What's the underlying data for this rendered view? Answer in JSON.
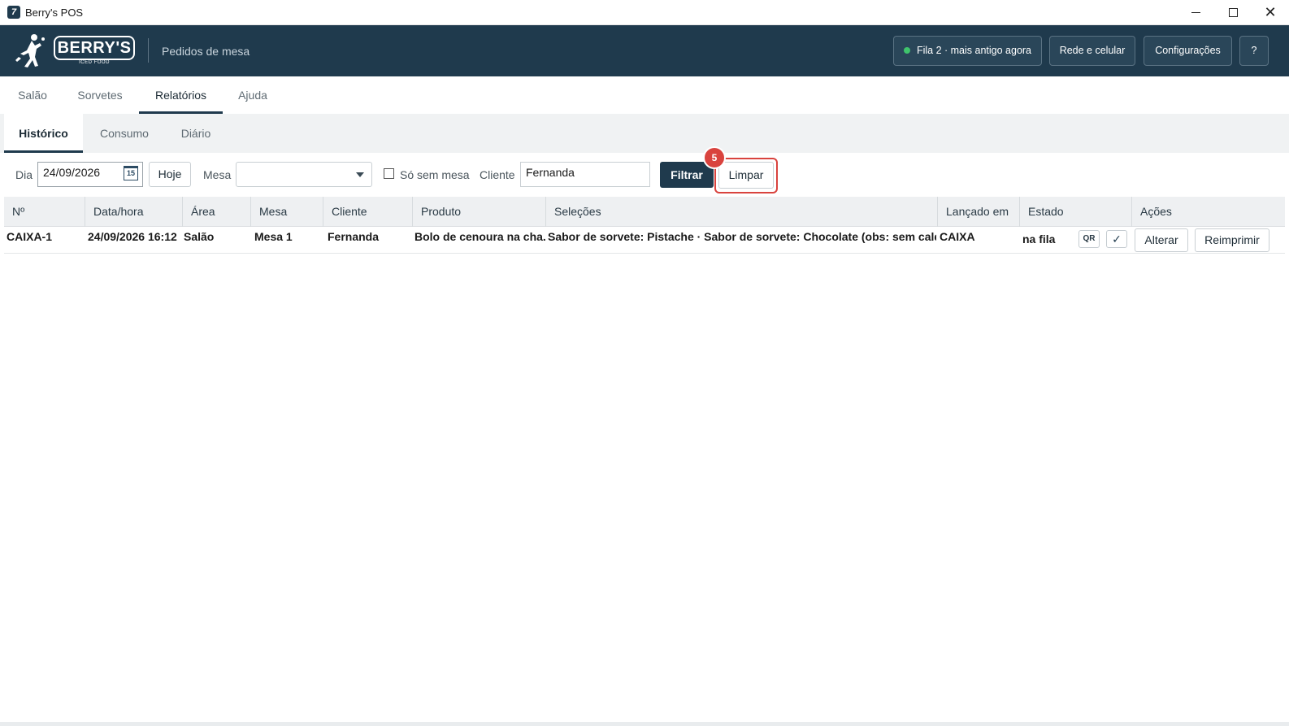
{
  "window": {
    "title": "Berry's POS",
    "app_icon_glyph": "7"
  },
  "header": {
    "logo_text": "BERRY'S",
    "logo_subtext": "ICED FOOD",
    "title": "Pedidos de mesa",
    "queue_status": "Fila 2 · mais antigo agora",
    "queue_dot_color": "#3fc46c",
    "network_button": "Rede e celular",
    "settings_button": "Configurações",
    "help_button": "?"
  },
  "main_tabs": [
    {
      "label": "Salão",
      "active": false
    },
    {
      "label": "Sorvetes",
      "active": false
    },
    {
      "label": "Relatórios",
      "active": true
    },
    {
      "label": "Ajuda",
      "active": false
    }
  ],
  "sub_tabs": [
    {
      "label": "Histórico",
      "active": true
    },
    {
      "label": "Consumo",
      "active": false
    },
    {
      "label": "Diário",
      "active": false
    }
  ],
  "filters": {
    "day_label": "Dia",
    "day_value": "24/09/2026",
    "calendar_glyph": "15",
    "today_button": "Hoje",
    "table_label": "Mesa",
    "table_value": "",
    "no_table_label": "Só sem mesa",
    "no_table_checked": false,
    "client_label": "Cliente",
    "client_value": "Fernanda",
    "filter_button": "Filtrar",
    "clear_button": "Limpar",
    "step_badge": "5"
  },
  "table": {
    "columns": [
      "Nº",
      "Data/hora",
      "Área",
      "Mesa",
      "Cliente",
      "Produto",
      "Seleções",
      "Lançado em",
      "Estado",
      "Ações"
    ],
    "rows": [
      {
        "numero": "CAIXA-1",
        "data_hora": "24/09/2026 16:12",
        "area": "Salão",
        "mesa": "Mesa 1",
        "cliente": "Fernanda",
        "produto": "Bolo de cenoura na cha...",
        "selecoes": "Sabor de sorvete: Pistache · Sabor de sorvete: Chocolate (obs: sem calda)",
        "lancado_em": "CAIXA",
        "estado": "na fila",
        "qr_label": "QR",
        "check_label": "✓",
        "alterar_label": "Alterar",
        "reimprimir_label": "Reimprimir"
      }
    ]
  },
  "colors": {
    "header_bg": "#1f3a4d",
    "accent": "#1f3a4d",
    "highlight": "#d9433e"
  }
}
